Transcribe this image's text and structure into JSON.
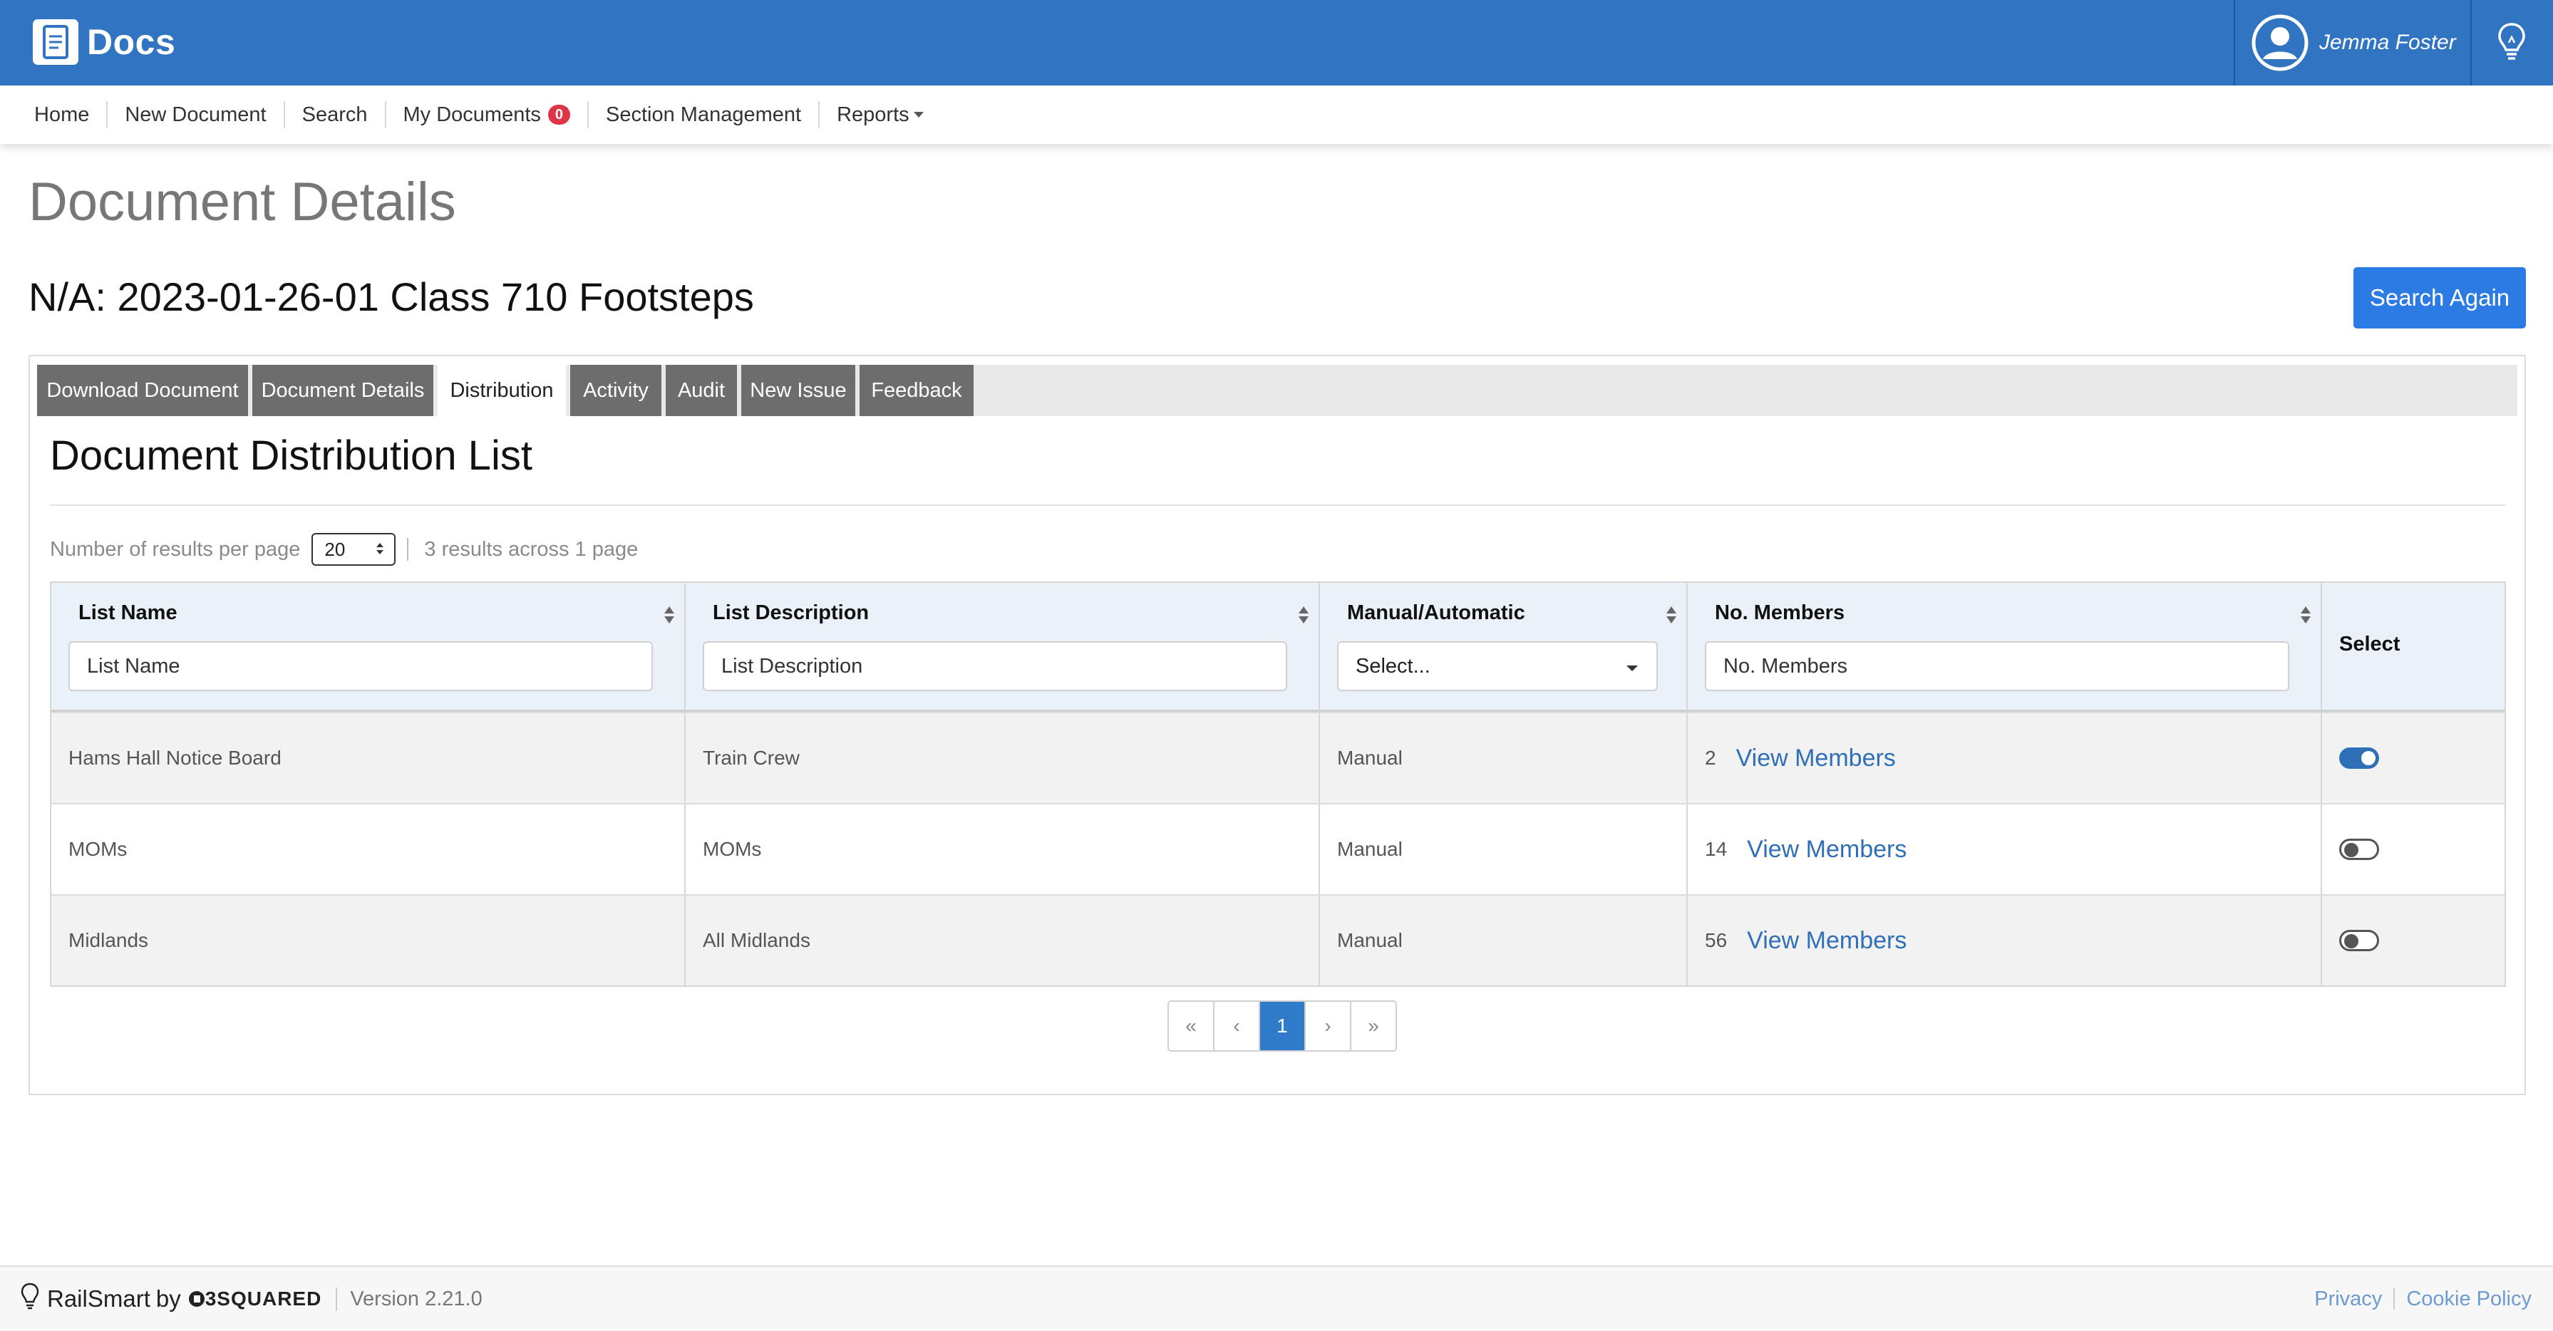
{
  "app": {
    "name": "Docs"
  },
  "user": {
    "name": "Jemma Foster"
  },
  "nav": {
    "items": [
      {
        "label": "Home"
      },
      {
        "label": "New Document"
      },
      {
        "label": "Search"
      },
      {
        "label": "My Documents",
        "badge": "0"
      },
      {
        "label": "Section Management"
      },
      {
        "label": "Reports",
        "dropdown": true
      }
    ]
  },
  "page": {
    "title": "Document Details",
    "doc_title": "N/A: 2023-01-26-01 Class 710 Footsteps",
    "search_again": "Search Again"
  },
  "tabs": [
    {
      "label": "Download Document"
    },
    {
      "label": "Document Details"
    },
    {
      "label": "Distribution",
      "active": true
    },
    {
      "label": "Activity"
    },
    {
      "label": "Audit"
    },
    {
      "label": "New Issue"
    },
    {
      "label": "Feedback"
    }
  ],
  "distribution": {
    "title": "Document Distribution List",
    "per_page_label": "Number of results per page",
    "per_page_value": "20",
    "results_summary": "3 results across 1 page",
    "columns": {
      "list_name": "List Name",
      "list_description": "List Description",
      "manual_automatic": "Manual/Automatic",
      "no_members": "No. Members",
      "select": "Select"
    },
    "filters": {
      "list_name": "List Name",
      "list_description": "List Description",
      "manual_automatic": "Select...",
      "no_members": "No. Members"
    },
    "rows": [
      {
        "list_name": "Hams Hall Notice Board",
        "description": "Train Crew",
        "type": "Manual",
        "members": "2",
        "link": "View Members",
        "selected": true
      },
      {
        "list_name": "MOMs",
        "description": "MOMs",
        "type": "Manual",
        "members": "14",
        "link": "View Members",
        "selected": false
      },
      {
        "list_name": "Midlands",
        "description": "All Midlands",
        "type": "Manual",
        "members": "56",
        "link": "View Members",
        "selected": false
      }
    ],
    "pagination": {
      "first": "«",
      "prev": "‹",
      "current": "1",
      "next": "›",
      "last": "»"
    }
  },
  "footer": {
    "brand": "RailSmart",
    "by": "by",
    "company": "3SQUARED",
    "version": "Version 2.21.0",
    "privacy": "Privacy",
    "cookie": "Cookie Policy"
  },
  "colors": {
    "topbar": "#3175c2",
    "primary_button": "#2c7be5",
    "link": "#2f6fb7",
    "badge": "#dc3545"
  }
}
